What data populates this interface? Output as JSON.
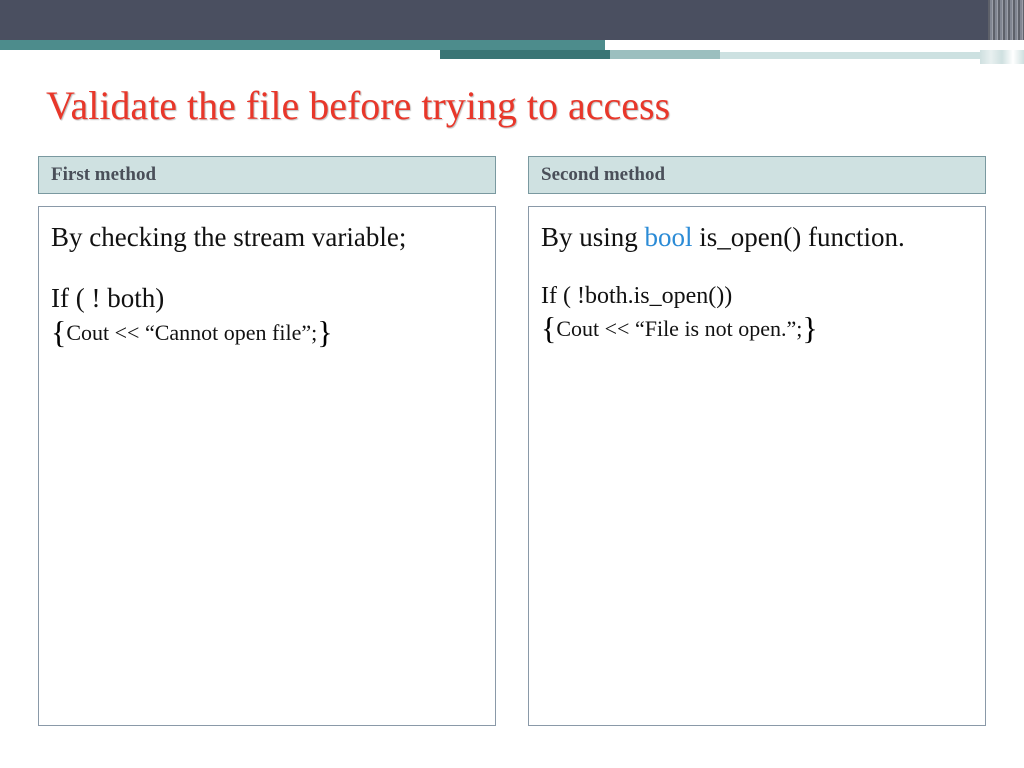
{
  "title": "Validate the file before trying to access",
  "left": {
    "header": "First method",
    "p1": "By checking the stream variable;",
    "p2": "If ( ! both)",
    "p3_open": "{",
    "p3_text": "Cout << “Cannot open file”;",
    "p3_close": "}"
  },
  "right": {
    "header": "Second method",
    "p1_a": "By using ",
    "p1_kw": "bool",
    "p1_b": " is_open() function.",
    "p2": "If ( !both.is_open())",
    "p3_open": "{",
    "p3_text": "Cout << “File is not open.”;",
    "p3_close": "}"
  }
}
